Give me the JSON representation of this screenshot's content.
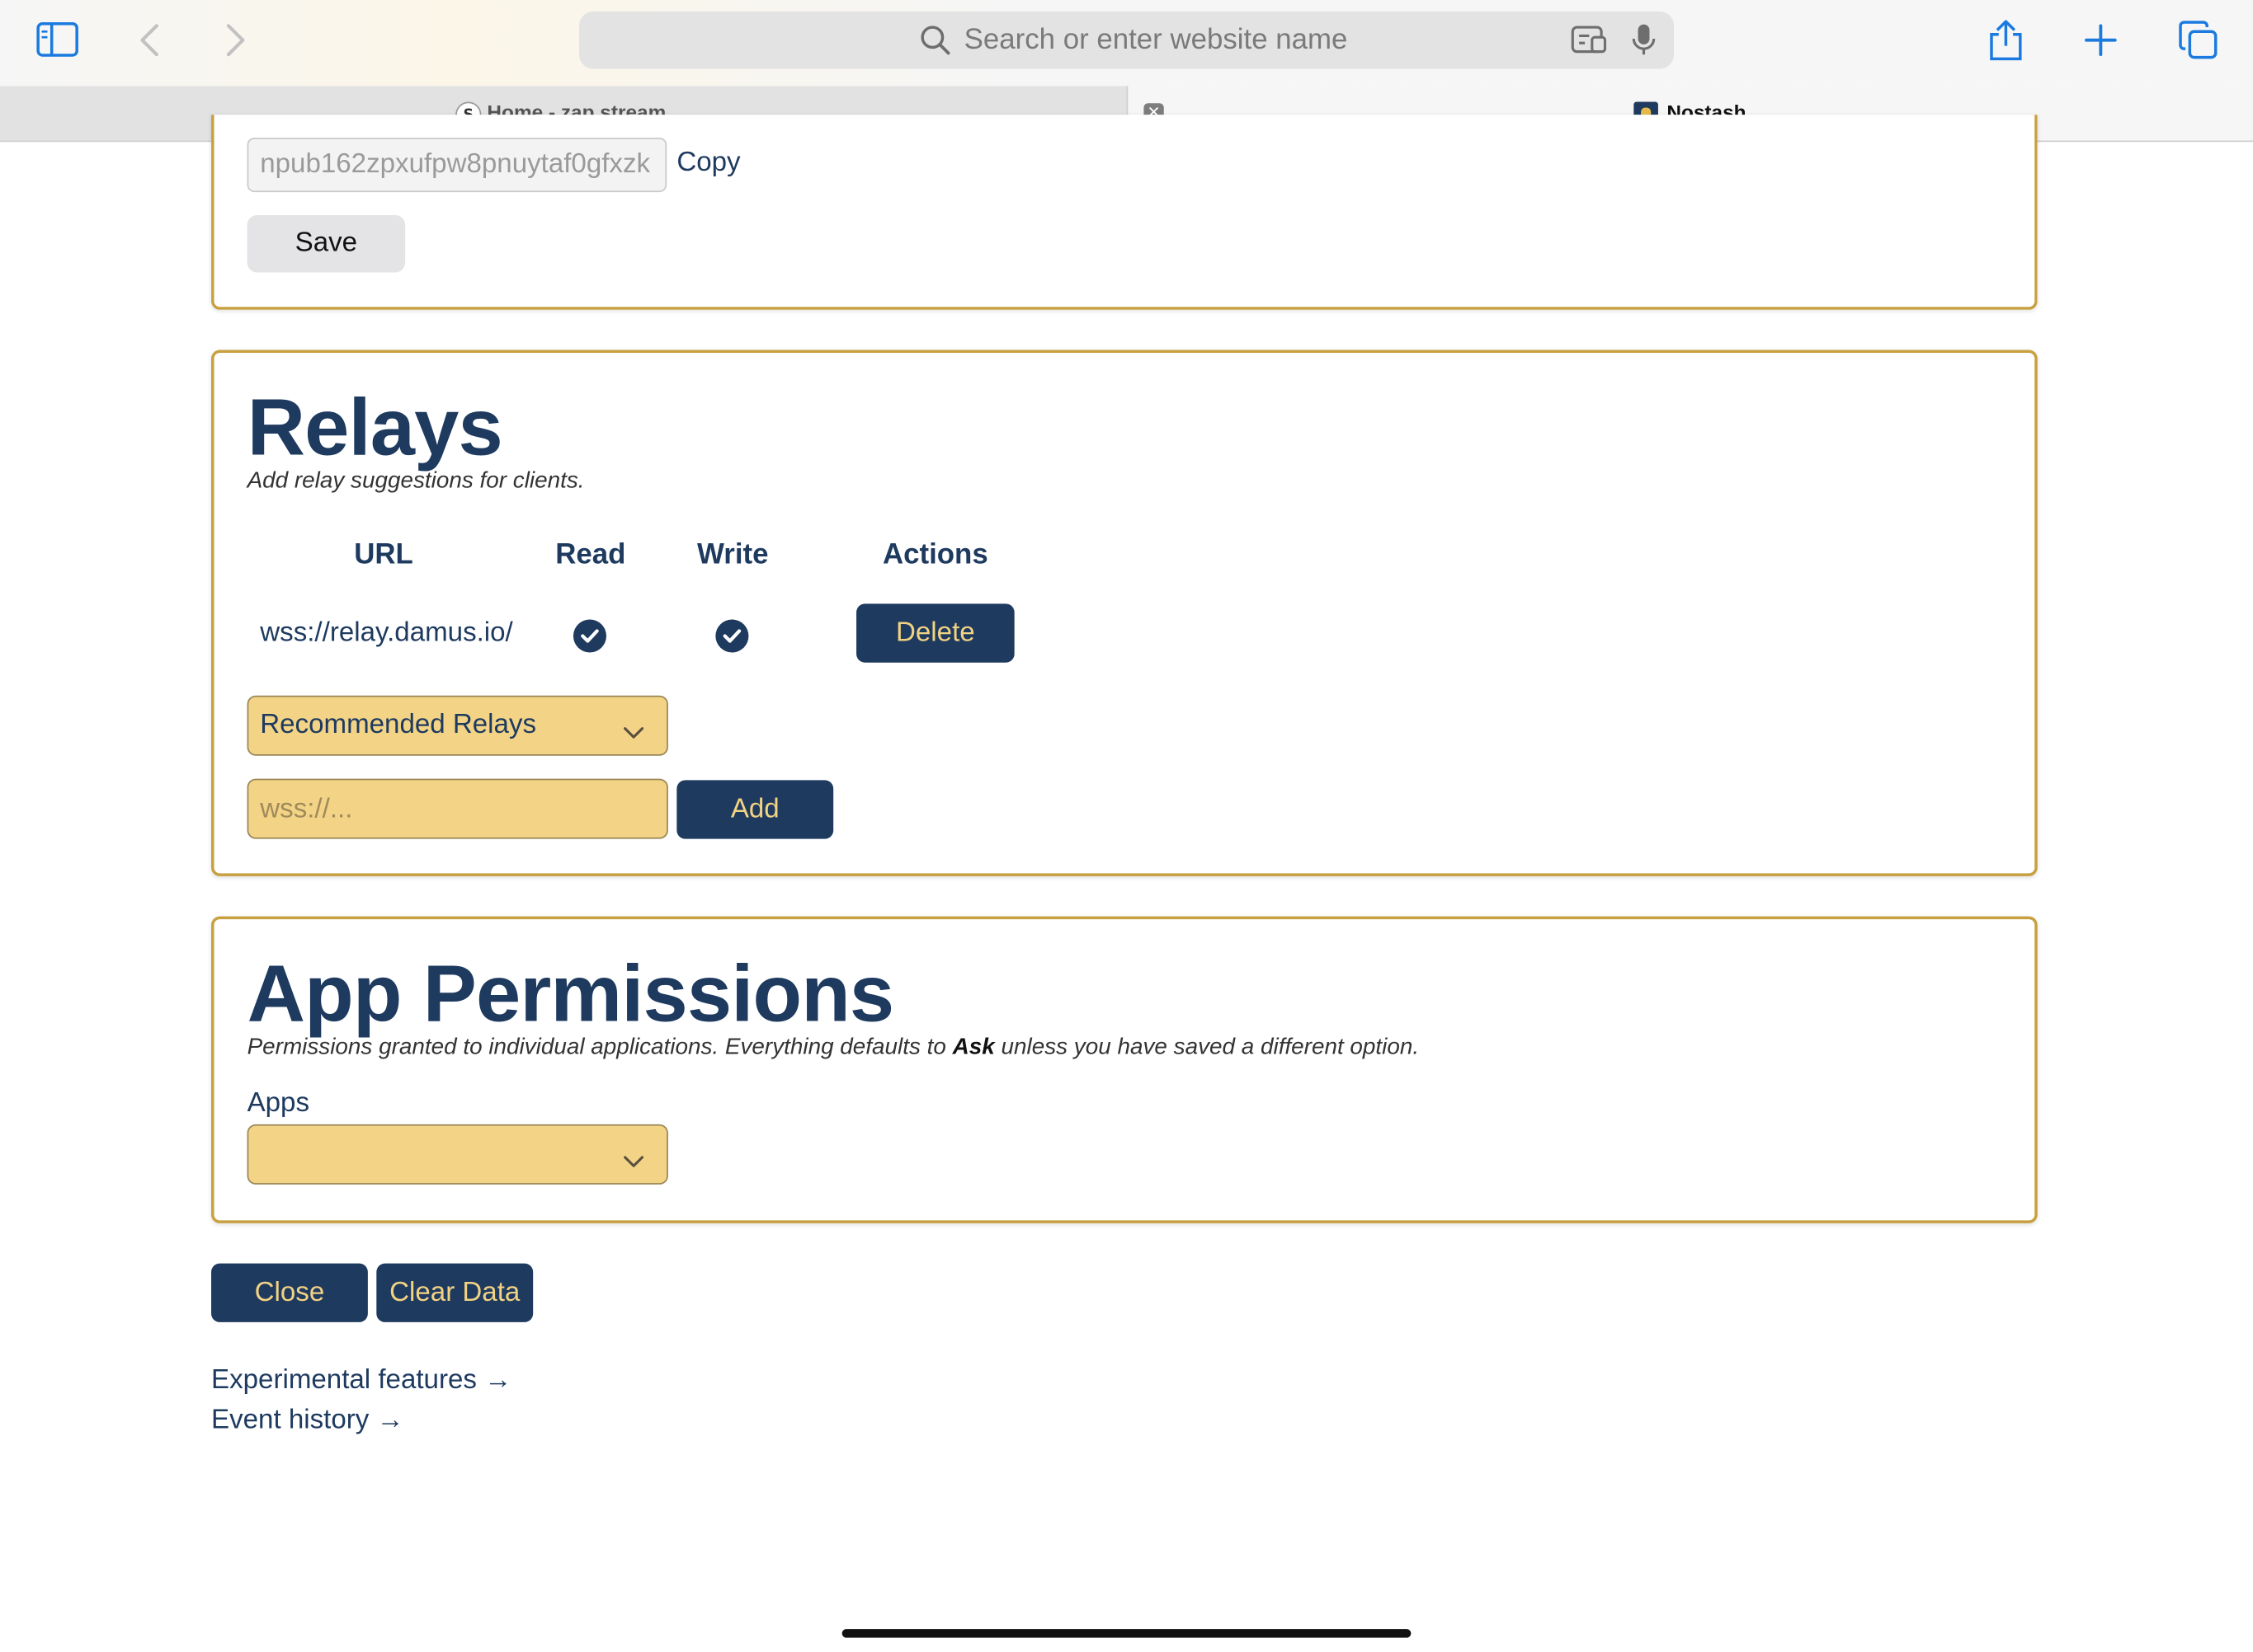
{
  "browser": {
    "address_placeholder": "Search or enter website name",
    "tabs": [
      {
        "label": "Home - zap.stream",
        "favicon": "zap-stream-icon",
        "active": false
      },
      {
        "label": "Nostash",
        "favicon": "nostash-icon",
        "active": true
      }
    ],
    "tab_close_glyph": "✕"
  },
  "profile": {
    "npub_value": "npub162zpxufpw8pnuytaf0gfxzk",
    "copy_label": "Copy",
    "save_label": "Save"
  },
  "relays": {
    "title": "Relays",
    "subtitle": "Add relay suggestions for clients.",
    "columns": [
      "URL",
      "Read",
      "Write",
      "Actions"
    ],
    "rows": [
      {
        "url": "wss://relay.damus.io/",
        "read": true,
        "write": true,
        "action": "Delete"
      }
    ],
    "recommended_select": "Recommended Relays",
    "new_relay_placeholder": "wss://...",
    "add_label": "Add"
  },
  "permissions": {
    "title": "App Permissions",
    "subtitle_before": "Permissions granted to individual applications. Everything defaults to ",
    "subtitle_bold": "Ask",
    "subtitle_after": " unless you have saved a different option.",
    "apps_label": "Apps",
    "apps_selected": ""
  },
  "footer": {
    "close_label": "Close",
    "clear_label": "Clear Data",
    "links": [
      "Experimental features →",
      "Event history →"
    ]
  },
  "colors": {
    "navy": "#1e3a5f",
    "gold_border": "#c8a040",
    "input_fill": "#f3d486",
    "button_text": "#f2d283"
  }
}
